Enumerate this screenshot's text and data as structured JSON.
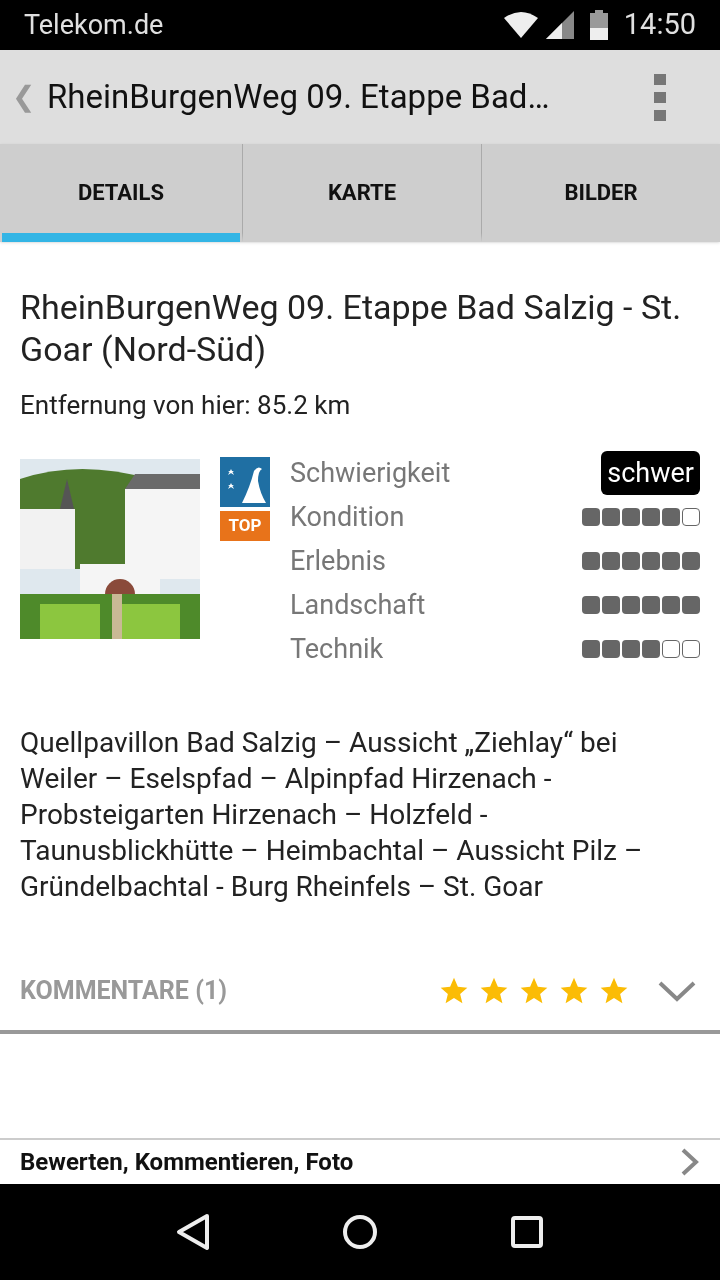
{
  "status_bar": {
    "carrier": "Telekom.de",
    "time": "14:50"
  },
  "app_bar": {
    "back": "❮",
    "title": "RheinBurgenWeg 09. Etappe Bad…"
  },
  "tabs": [
    {
      "label": "DETAILS",
      "selected": true
    },
    {
      "label": "KARTE",
      "selected": false
    },
    {
      "label": "BILDER",
      "selected": false
    }
  ],
  "tour": {
    "title": "RheinBurgenWeg 09. Etappe Bad Salzig - St. Goar (Nord-Süd)",
    "distance": "Entfernung von hier: 85.2 km",
    "top_badge": "TOP",
    "ratings": [
      {
        "kind": "badge",
        "label": "Schwierigkeit",
        "value": "schwer"
      },
      {
        "kind": "dots",
        "label": "Kondition",
        "stars": 5
      },
      {
        "kind": "dots",
        "label": "Erlebnis",
        "stars": 6
      },
      {
        "kind": "dots",
        "label": "Landschaft",
        "stars": 6
      },
      {
        "kind": "dots",
        "label": "Technik",
        "stars": 4
      }
    ],
    "description": "Quellpavillon Bad Salzig – Aussicht „Ziehlay“ bei Weiler – Eselspfad – Alpinpfad Hirzenach - Probsteigarten Hirzenach – Holzfeld - Taunusblickhütte – Heimbachtal – Aussicht Pilz – Gründelbachtal - Burg Rheinfels – St. Goar"
  },
  "comments": {
    "label": "KOMMENTARE (1)",
    "stars": 5,
    "expanded": false
  },
  "action_row": {
    "label": "Bewerten, Kommentieren, Foto"
  }
}
